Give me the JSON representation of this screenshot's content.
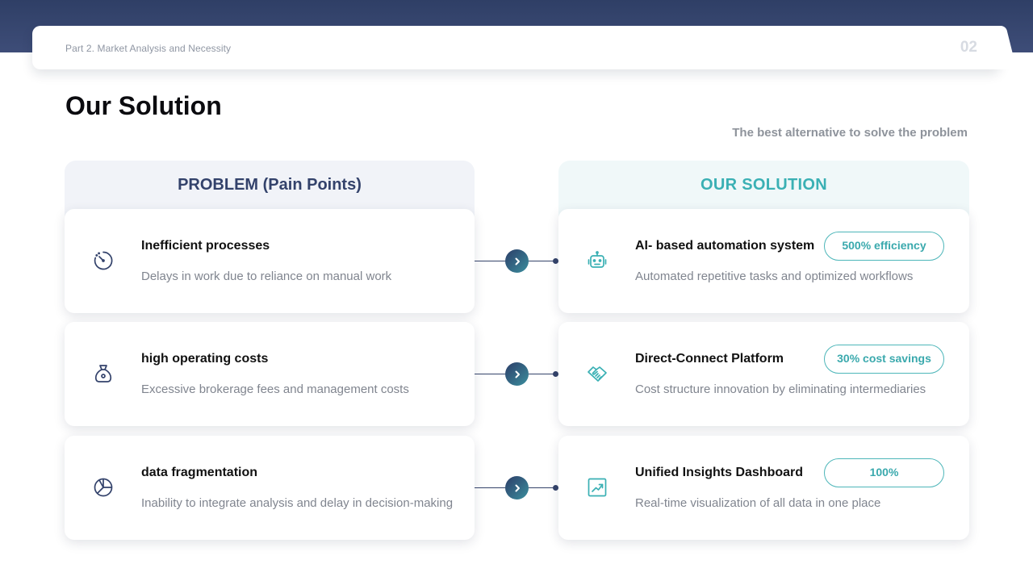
{
  "header": {
    "section_title": "Part 2. Market Analysis and Necessity",
    "page_number": "02"
  },
  "page": {
    "title": "Our Solution",
    "subtitle": "The best alternative to solve the problem"
  },
  "problems": {
    "heading": "PROBLEM (Pain Points)",
    "items": [
      {
        "icon": "timer-icon",
        "title": "Inefficient processes",
        "description": "Delays in work due to reliance on manual work"
      },
      {
        "icon": "money-bag-icon",
        "title": "high operating costs",
        "description": "Excessive brokerage fees and management costs"
      },
      {
        "icon": "pie-chart-icon",
        "title": "data fragmentation",
        "description": "Inability to integrate analysis and delay in decision-making"
      }
    ]
  },
  "solutions": {
    "heading": "OUR SOLUTION",
    "items": [
      {
        "icon": "robot-icon",
        "title": "AI- based automation system",
        "description": "Automated repetitive tasks and optimized workflows",
        "badge": "500% efficiency"
      },
      {
        "icon": "handshake-icon",
        "title": "Direct-Connect Platform",
        "description": "Cost structure innovation by eliminating intermediaries",
        "badge": "30% cost savings"
      },
      {
        "icon": "trending-chart-icon",
        "title": "Unified Insights Dashboard",
        "description": "Real-time visualization of all data in one place",
        "badge": "100%"
      }
    ]
  },
  "colors": {
    "navy": "#33426b",
    "teal": "#3ab0b4",
    "muted_text": "#80858f"
  }
}
